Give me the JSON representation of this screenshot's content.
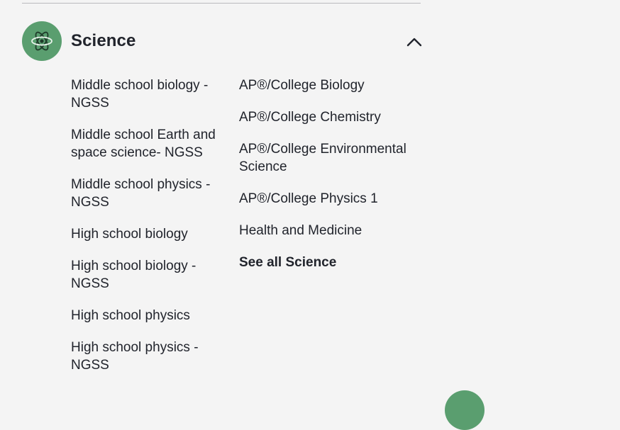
{
  "section": {
    "title": "Science",
    "icon": "atom-icon",
    "accent_color": "#5a9e6f",
    "expanded_icon": "chevron-up-icon"
  },
  "left_links": [
    {
      "label": "Middle school biology - NGSS"
    },
    {
      "label": "Middle school Earth and space science- NGSS"
    },
    {
      "label": "Middle school physics - NGSS"
    },
    {
      "label": "High school biology"
    },
    {
      "label": "High school biology - NGSS"
    },
    {
      "label": "High school physics"
    },
    {
      "label": "High school physics - NGSS"
    }
  ],
  "right_links": [
    {
      "label": "AP®/College Biology"
    },
    {
      "label": "AP®/College Chemistry"
    },
    {
      "label": "AP®/College Environmental Science"
    },
    {
      "label": "AP®/College Physics 1"
    },
    {
      "label": "Health and Medicine"
    }
  ],
  "see_all_label": "See all Science"
}
